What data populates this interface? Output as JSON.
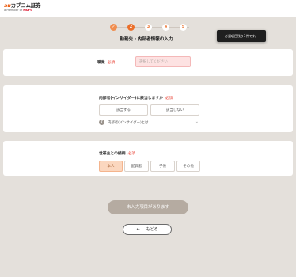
{
  "header": {
    "logo_au": "au",
    "logo_text": "カブコム証券",
    "logo_sub_prefix": "a member of",
    "logo_sub_brand": "MUFG"
  },
  "stepper": {
    "steps": [
      {
        "label": "✓",
        "state": "done"
      },
      {
        "label": "2",
        "state": "current"
      },
      {
        "label": "3",
        "state": "todo"
      },
      {
        "label": "4",
        "state": "todo"
      },
      {
        "label": "5",
        "state": "todo"
      }
    ]
  },
  "page_title": "勤務先・内部者情報の入力",
  "toast": "必須項目残り3件です。",
  "occupation": {
    "label": "職業",
    "required": "必須",
    "placeholder": "選択してください"
  },
  "insider": {
    "label": "内部者(インサイダー)に該当しますか",
    "required": "必須",
    "options": [
      "該当する",
      "該当しない"
    ],
    "hint": "内部者(インサイダー)とは..."
  },
  "relation": {
    "label": "世帯主との続柄",
    "required": "必須",
    "options": [
      "本人",
      "配偶者",
      "子供",
      "その他"
    ],
    "selected": "本人"
  },
  "submit_label": "未入力項目があります",
  "back_label": "もどる",
  "colors": {
    "accent": "#eb6f2a",
    "required": "#e8392b",
    "background": "#e4e0db"
  }
}
